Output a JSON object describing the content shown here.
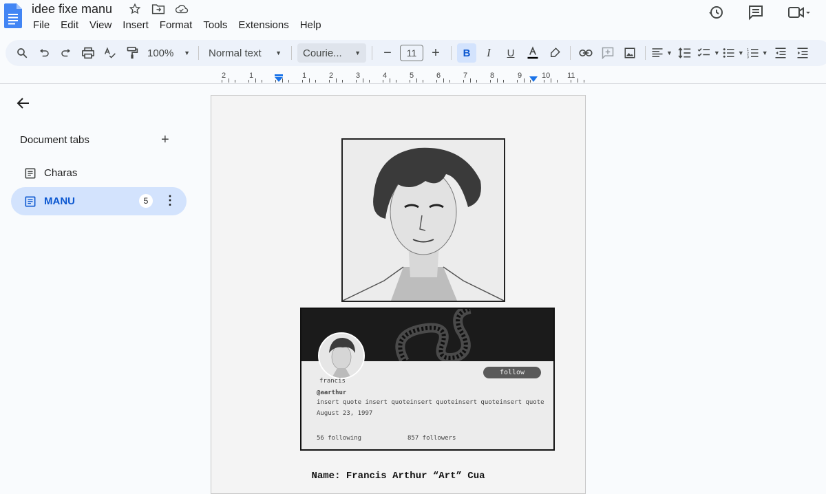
{
  "doc": {
    "title": "idee fixe manu"
  },
  "menu": [
    "File",
    "Edit",
    "View",
    "Insert",
    "Format",
    "Tools",
    "Extensions",
    "Help"
  ],
  "toolbar": {
    "zoom": "100%",
    "style": "Normal text",
    "font": "Courie...",
    "font_size": "11"
  },
  "ruler": [
    "2",
    "1",
    "1",
    "2",
    "3",
    "4",
    "5",
    "6",
    "7",
    "8",
    "9",
    "10",
    "11"
  ],
  "sidebar": {
    "heading": "Document tabs",
    "tabs": [
      {
        "label": "Charas"
      },
      {
        "label": "MANU",
        "badge": "5"
      }
    ]
  },
  "card": {
    "display_name": "francis",
    "handle": "@aarthur",
    "bio": "insert quote insert quoteinsert quoteinsert quoteinsert quote",
    "date": "August 23, 1997",
    "following": "56 following",
    "followers": "857 followers",
    "follow_label": "follow"
  },
  "body": {
    "name_line": "Name: Francis Arthur “Art” Cua"
  },
  "colors": {
    "accent": "#0b57d0",
    "tab_active_bg": "#d3e3fd",
    "toolbar_bg": "#edf2fa",
    "doc_icon": "#4285f4"
  },
  "icons": [
    "docs-logo-icon",
    "star-icon",
    "move-folder-icon",
    "cloud-saved-icon",
    "history-icon",
    "comment-icon",
    "meet-icon",
    "search-icon",
    "undo-icon",
    "redo-icon",
    "print-icon",
    "spellcheck-icon",
    "paint-format-icon",
    "text-color-icon",
    "highlighter-icon",
    "link-icon",
    "add-comment-icon",
    "image-icon",
    "align-icon",
    "line-spacing-icon",
    "checklist-icon",
    "bullet-list-icon",
    "numbered-list-icon",
    "decrease-indent-icon",
    "increase-indent-icon",
    "back-arrow-icon",
    "plus-icon",
    "document-icon",
    "more-vert-icon"
  ]
}
